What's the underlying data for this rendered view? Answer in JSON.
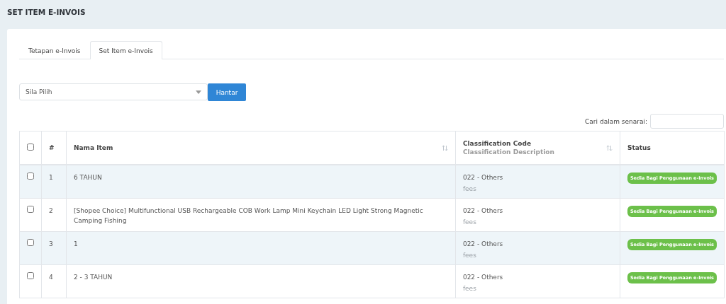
{
  "page_title": "SET ITEM E-INVOIS",
  "tabs": [
    {
      "label": "Tetapan e-Invois",
      "selected": false
    },
    {
      "label": "Set Item e-Invois",
      "selected": true
    }
  ],
  "select": {
    "placeholder": "Sila Pilih"
  },
  "submit_button": "Hantar",
  "search": {
    "label": "Cari dalam senarai:"
  },
  "table": {
    "select_all_checked": false,
    "columns": [
      {
        "label": "#",
        "sortable": false
      },
      {
        "label": "Nama Item",
        "sortable": true
      },
      {
        "label": "Classification Code",
        "sublabel": "Classification Description",
        "sortable": true
      },
      {
        "label": "Status",
        "sortable": false
      }
    ],
    "rows": [
      {
        "checked": false,
        "number": "1",
        "name": "6 TAHUN",
        "code": "022 - Others",
        "description": "fees",
        "status": "Sedia Bagi Penggunaan e-Invois",
        "color": "#6cc04a"
      },
      {
        "checked": false,
        "number": "2",
        "name": "[Shopee Choice] Multifunctional USB Rechargeable COB Work Lamp Mini Keychain LED Light Strong Magnetic Camping Fishing",
        "code": "022 - Others",
        "description": "fees",
        "status": "Sedia Bagi Penggunaan e-Invois",
        "color": "#6cc04a"
      },
      {
        "checked": false,
        "number": "3",
        "name": "1",
        "code": "022 - Others",
        "description": "fees",
        "status": "Sedia Bagi Penggunaan e-Invois",
        "color": "#6cc04a"
      },
      {
        "checked": false,
        "number": "4",
        "name": "2 - 3 TAHUN",
        "code": "022 - Others",
        "description": "fees",
        "status": "Sedia Bagi Penggunaan e-Invois",
        "color": "#6cc04a"
      }
    ]
  }
}
